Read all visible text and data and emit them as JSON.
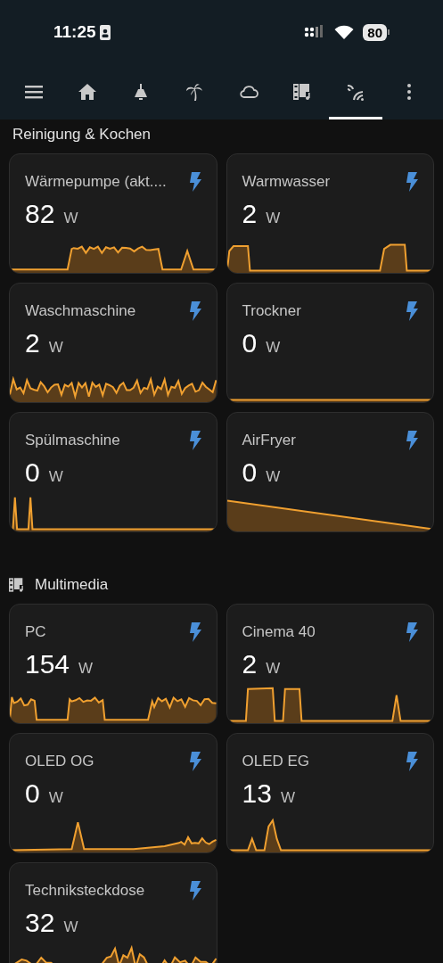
{
  "status_bar": {
    "time": "11:25",
    "battery": "80"
  },
  "tabs": [
    {
      "kind": "menu",
      "selected": false
    },
    {
      "kind": "home",
      "selected": false
    },
    {
      "kind": "lamp",
      "selected": false
    },
    {
      "kind": "palm",
      "selected": false
    },
    {
      "kind": "cloud",
      "selected": false
    },
    {
      "kind": "media",
      "selected": false
    },
    {
      "kind": "signal",
      "selected": true
    },
    {
      "kind": "more",
      "selected": false
    }
  ],
  "sections": [
    {
      "title": "Reinigung & Kochen",
      "cards": [
        {
          "name": "Wärmepumpe (akt....",
          "value": "82",
          "unit": "W"
        },
        {
          "name": "Warmwasser",
          "value": "2",
          "unit": "W"
        },
        {
          "name": "Waschmaschine",
          "value": "2",
          "unit": "W"
        },
        {
          "name": "Trockner",
          "value": "0",
          "unit": "W"
        },
        {
          "name": "Spülmaschine",
          "value": "0",
          "unit": "W"
        },
        {
          "name": "AirFryer",
          "value": "0",
          "unit": "W"
        }
      ]
    },
    {
      "title": "Multimedia",
      "kind": "media",
      "cards": [
        {
          "name": "PC",
          "value": "154",
          "unit": "W"
        },
        {
          "name": "Cinema 40",
          "value": "2",
          "unit": "W"
        },
        {
          "name": "OLED OG",
          "value": "0",
          "unit": "W"
        },
        {
          "name": "OLED EG",
          "value": "13",
          "unit": "W"
        },
        {
          "name": "Techniksteckdose",
          "value": "32",
          "unit": "W"
        }
      ]
    }
  ]
}
